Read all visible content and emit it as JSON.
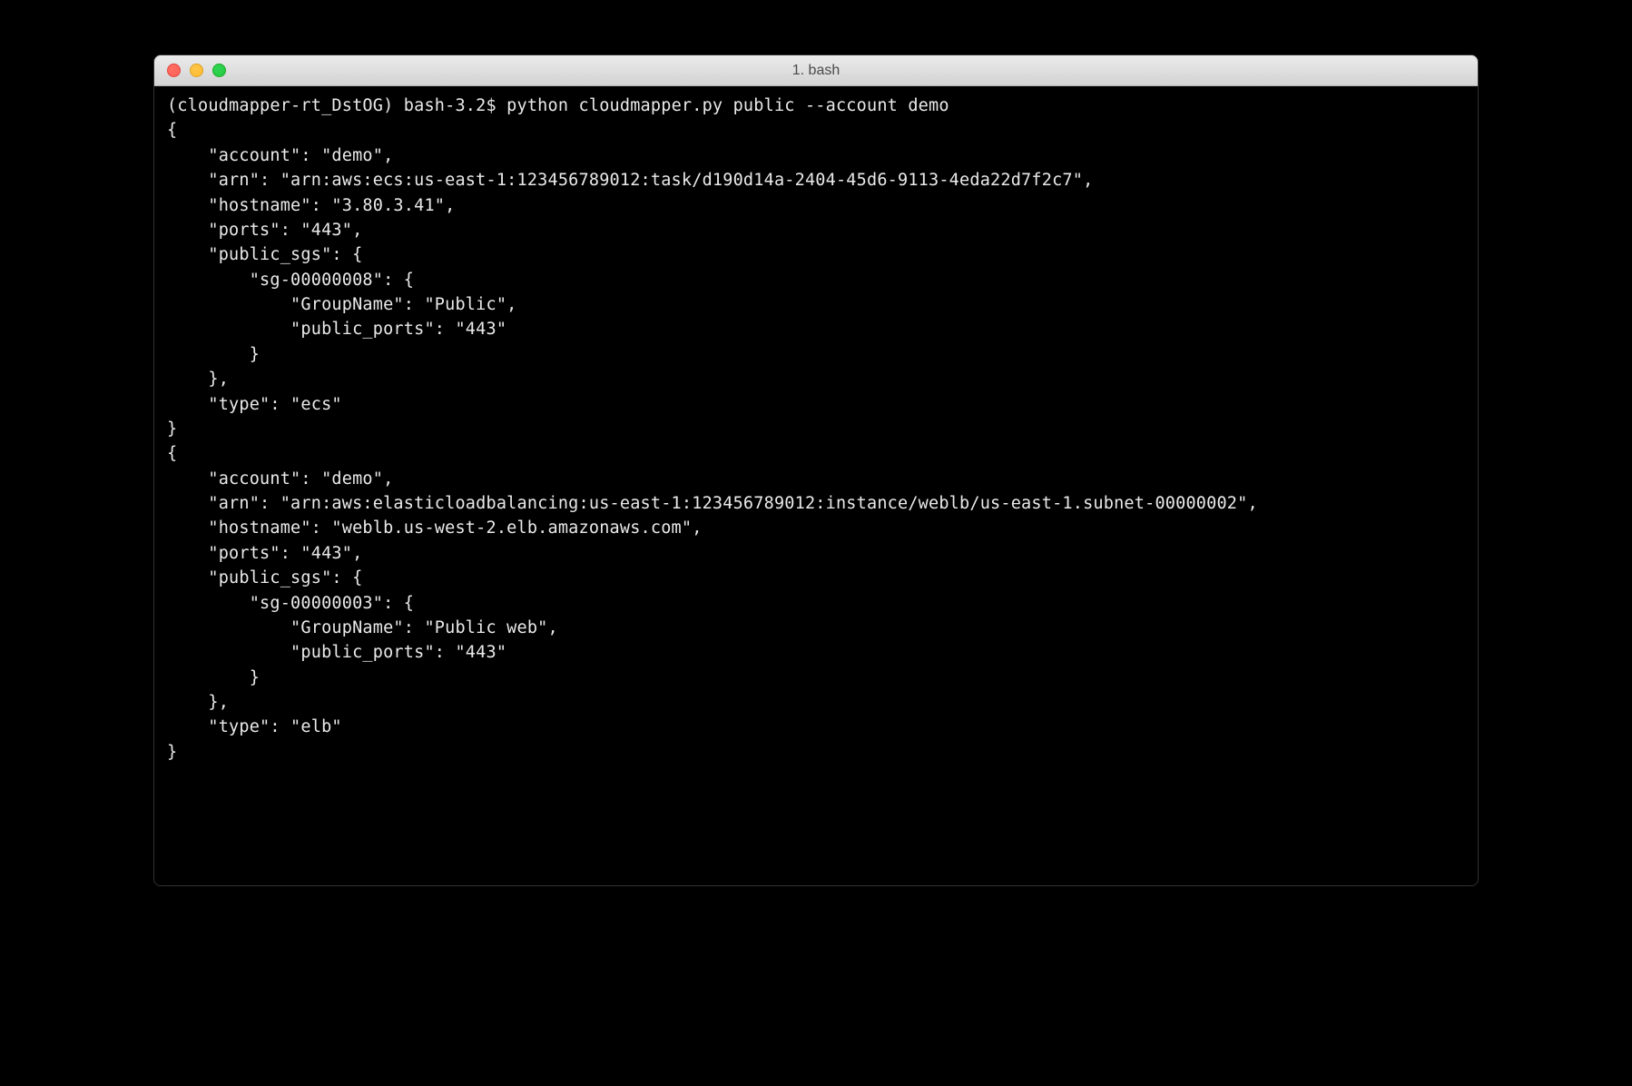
{
  "window": {
    "title": "1. bash"
  },
  "terminal": {
    "prompt": "(cloudmapper-rt_DstOG) bash-3.2$ ",
    "command": "python cloudmapper.py public --account demo",
    "output_lines": [
      "{",
      "    \"account\": \"demo\",",
      "    \"arn\": \"arn:aws:ecs:us-east-1:123456789012:task/d190d14a-2404-45d6-9113-4eda22d7f2c7\",",
      "    \"hostname\": \"3.80.3.41\",",
      "    \"ports\": \"443\",",
      "    \"public_sgs\": {",
      "        \"sg-00000008\": {",
      "            \"GroupName\": \"Public\",",
      "            \"public_ports\": \"443\"",
      "        }",
      "    },",
      "    \"type\": \"ecs\"",
      "}",
      "{",
      "    \"account\": \"demo\",",
      "    \"arn\": \"arn:aws:elasticloadbalancing:us-east-1:123456789012:instance/weblb/us-east-1.subnet-00000002\",",
      "    \"hostname\": \"weblb.us-west-2.elb.amazonaws.com\",",
      "    \"ports\": \"443\",",
      "    \"public_sgs\": {",
      "        \"sg-00000003\": {",
      "            \"GroupName\": \"Public web\",",
      "            \"public_ports\": \"443\"",
      "        }",
      "    },",
      "    \"type\": \"elb\"",
      "}"
    ]
  }
}
